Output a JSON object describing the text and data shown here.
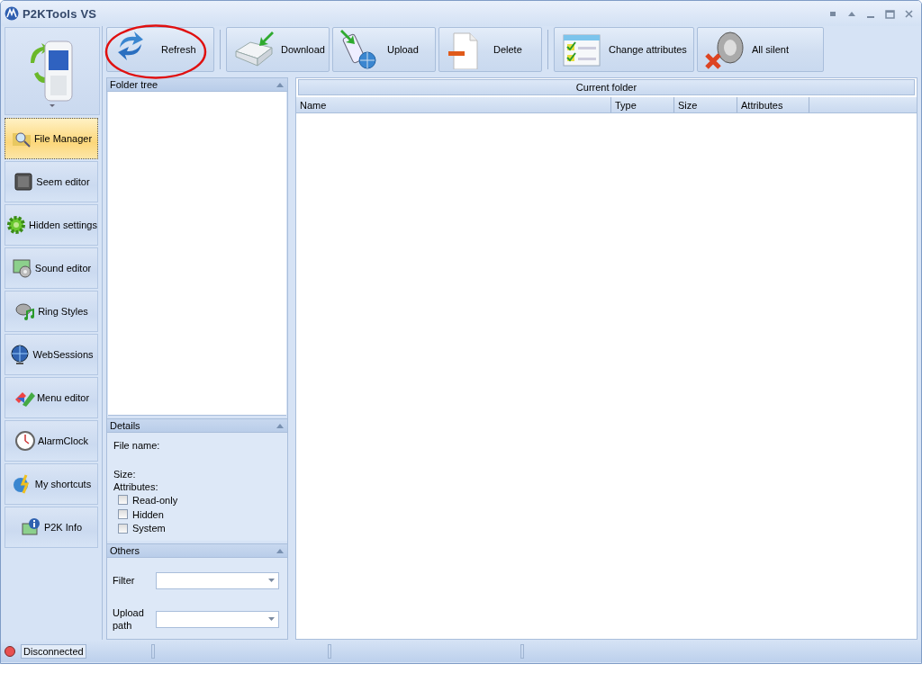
{
  "window": {
    "title": "P2KTools VS"
  },
  "toolbar": [
    {
      "label": "Refresh"
    },
    {
      "label": "Download"
    },
    {
      "label": "Upload"
    },
    {
      "label": "Delete"
    },
    {
      "label": "Change attributes"
    },
    {
      "label": "All silent"
    }
  ],
  "sidebar": {
    "items": [
      {
        "label": "File Manager",
        "selected": true
      },
      {
        "label": "Seem editor",
        "selected": false
      },
      {
        "label": "Hidden settings",
        "selected": false
      },
      {
        "label": "Sound editor",
        "selected": false
      },
      {
        "label": "Ring Styles",
        "selected": false
      },
      {
        "label": "WebSessions",
        "selected": false
      },
      {
        "label": "Menu editor",
        "selected": false
      },
      {
        "label": "AlarmClock",
        "selected": false
      },
      {
        "label": "My shortcuts",
        "selected": false
      },
      {
        "label": "P2K Info",
        "selected": false
      }
    ]
  },
  "folder_tree": {
    "title": "Folder tree"
  },
  "details": {
    "title": "Details",
    "file_name_label": "File name:",
    "size_label": "Size:",
    "attributes_label": "Attributes:",
    "attributes": [
      {
        "label": "Read-only",
        "checked": false
      },
      {
        "label": "Hidden",
        "checked": false
      },
      {
        "label": "System",
        "checked": false
      }
    ]
  },
  "others": {
    "title": "Others",
    "fields": [
      {
        "label": "Filter"
      },
      {
        "label": "Upload path"
      }
    ]
  },
  "current_folder": {
    "title": "Current folder",
    "columns": [
      "Name",
      "Type",
      "Size",
      "Attributes"
    ]
  },
  "status_bar": {
    "text": "Disconnected",
    "connected": false
  }
}
